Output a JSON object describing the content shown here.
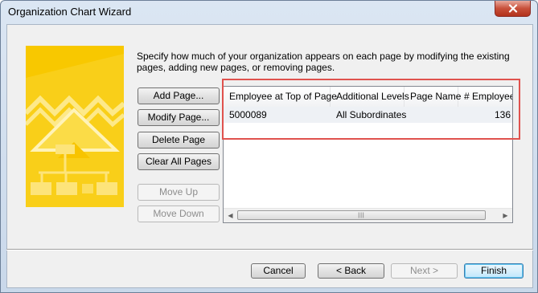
{
  "window": {
    "title": "Organization Chart Wizard"
  },
  "instructions": "Specify how much of your organization appears on each page by modifying the existing pages, adding new pages, or removing pages.",
  "side_buttons": {
    "add_page": "Add Page...",
    "modify_page": "Modify Page...",
    "delete_page": "Delete Page",
    "clear_all_pages": "Clear All Pages",
    "move_up": "Move Up",
    "move_down": "Move Down"
  },
  "pages_list": {
    "columns": [
      "Employee at Top of Page",
      "Additional Levels",
      "Page Name",
      "# Employees"
    ],
    "rows": [
      {
        "employee": "5000089",
        "levels": "All Subordinates",
        "page_name": "",
        "employees": "136"
      }
    ]
  },
  "footer_buttons": {
    "cancel": "Cancel",
    "back": "< Back",
    "next": "Next >",
    "finish": "Finish"
  },
  "colors": {
    "highlight": "#e0524e",
    "banner": "#f7c600"
  }
}
